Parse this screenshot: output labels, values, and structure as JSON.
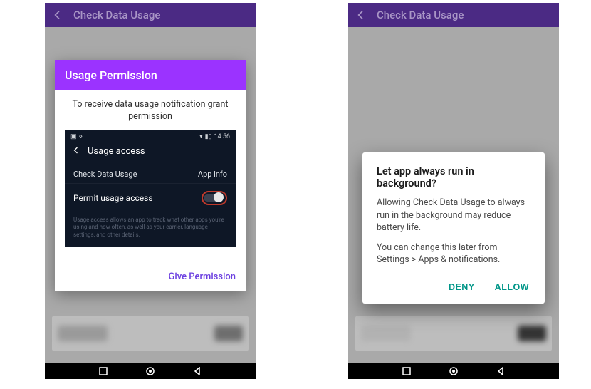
{
  "appbar": {
    "title": "Check Data Usage"
  },
  "left_dialog": {
    "header": "Usage Permission",
    "message": "To receive data usage notification grant permission",
    "preview": {
      "time": "14:56",
      "screen_title": "Usage access",
      "app_name": "Check Data Usage",
      "app_info_label": "App info",
      "toggle_label": "Permit usage access",
      "help_text": "Usage access allows an app to track what other apps you're using and how often, as well as your carrier, language settings, and other details."
    },
    "action_label": "Give Permission"
  },
  "right_dialog": {
    "title": "Let app always run in background?",
    "body1": "Allowing Check Data Usage to always run in the background may reduce battery life.",
    "body2": "You can change this later from Settings > Apps & notifications.",
    "deny_label": "DENY",
    "allow_label": "ALLOW"
  }
}
